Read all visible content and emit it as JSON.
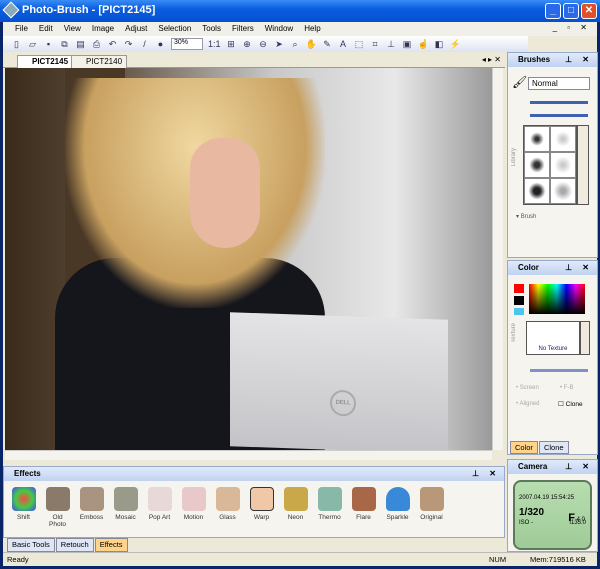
{
  "window": {
    "title": "Photo-Brush - [PICT2145]",
    "minimize": "_",
    "maximize": "□",
    "close": "✕"
  },
  "menu": [
    "File",
    "Edit",
    "View",
    "Image",
    "Adjust",
    "Selection",
    "Tools",
    "Filters",
    "Window",
    "Help"
  ],
  "menu_mdi": "_ ▫ ✕",
  "toolbar": {
    "zoom": "30%",
    "zoom_reset": "1:1"
  },
  "doc_tabs": [
    {
      "label": "PICT2145",
      "active": true
    },
    {
      "label": "PICT2140",
      "active": false
    }
  ],
  "doc_tab_controls": "◂ ▸ ✕",
  "brushes": {
    "title": "Brushes",
    "mode": "Normal",
    "library": "Library",
    "brush": "Brush"
  },
  "color": {
    "title": "Color",
    "primary": "#ff0000",
    "secondary": "#000000",
    "texture_label": "Texture",
    "texture": "No Texture",
    "screen": "Screen",
    "fb": "F-B",
    "aligned": "Aligned",
    "clone": "Clone",
    "tabs": [
      "Color",
      "Clone"
    ]
  },
  "camera": {
    "title": "Camera",
    "datetime": "2007.04.19 15:54:25",
    "shutter": "1/320",
    "aperture_label": "F",
    "aperture": "4.0",
    "iso": "ISO -",
    "focal": "f135.0"
  },
  "effects": {
    "title": "Effects",
    "items": [
      "Shift",
      "Old Photo",
      "Emboss",
      "Mosaic",
      "Pop Art",
      "Motion",
      "Glass",
      "Warp",
      "Neon",
      "Thermo",
      "Flare",
      "Sparkle",
      "Original"
    ]
  },
  "bottom_tabs": [
    {
      "label": "Basic Tools",
      "active": false
    },
    {
      "label": "Retouch",
      "active": false
    },
    {
      "label": "Effects",
      "active": true
    }
  ],
  "panel_ctl": "⊥ ✕",
  "status": {
    "text": "Ready",
    "num": "NUM",
    "mem": "Mem:719516 KB"
  },
  "laptop_logo": "DELL"
}
